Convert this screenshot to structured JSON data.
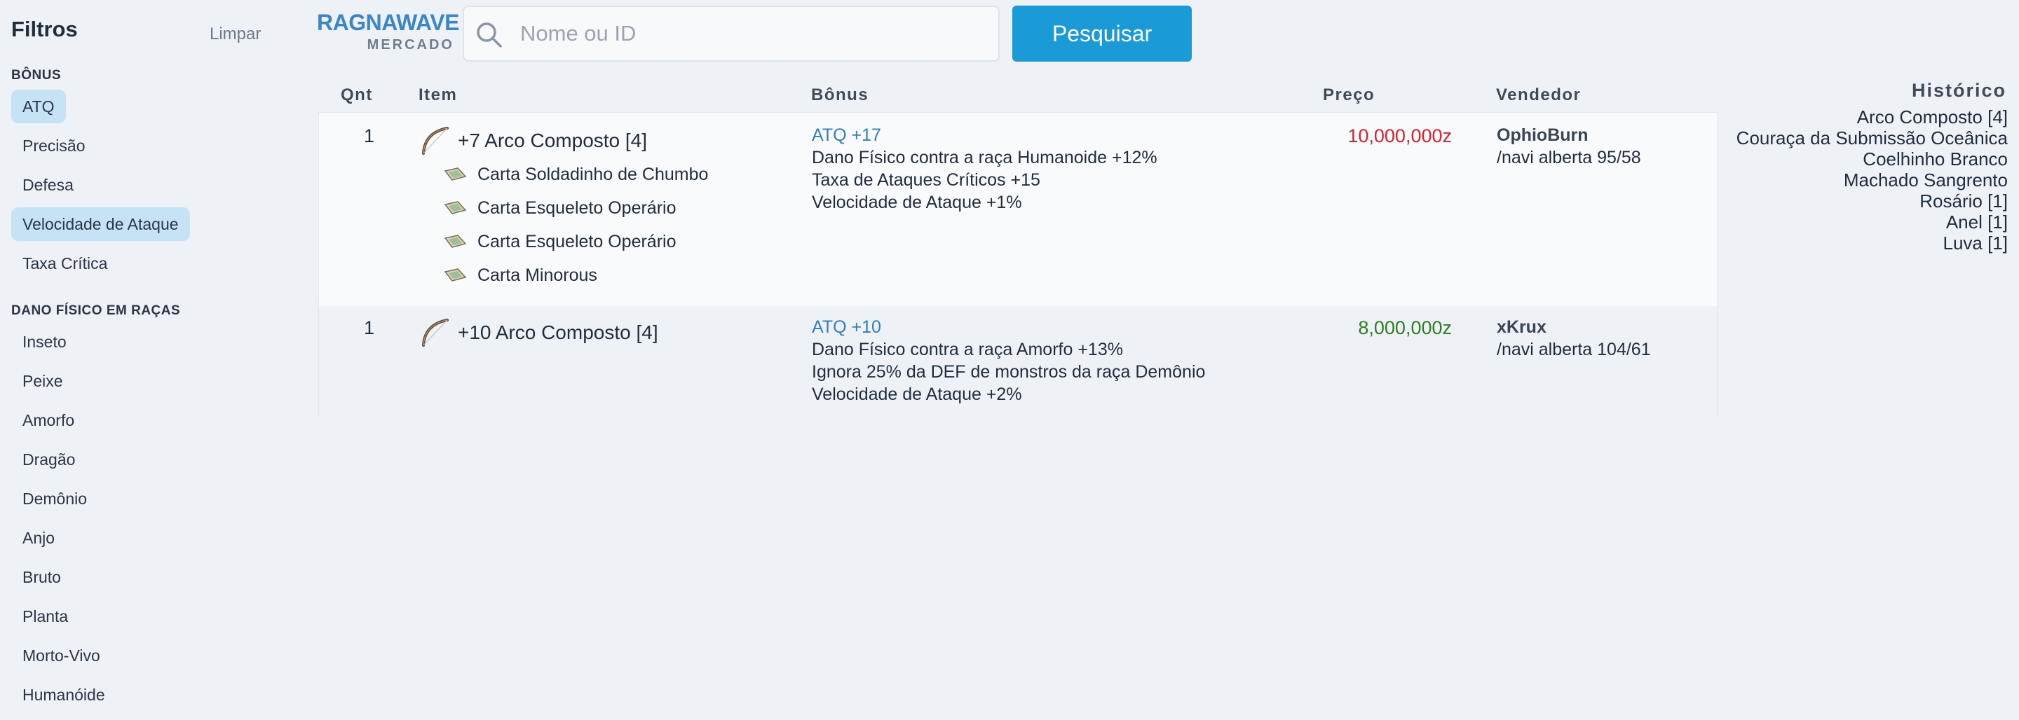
{
  "sidebar": {
    "title": "Filtros",
    "clear_label": "Limpar",
    "sections": [
      {
        "title": "BÔNUS",
        "items": [
          {
            "label": "ATQ",
            "active": true
          },
          {
            "label": "Precisão",
            "active": false
          },
          {
            "label": "Defesa",
            "active": false
          },
          {
            "label": "Velocidade de Ataque",
            "active": true
          },
          {
            "label": "Taxa Crítica",
            "active": false
          }
        ]
      },
      {
        "title": "DANO FÍSICO EM RAÇAS",
        "items": [
          {
            "label": "Inseto"
          },
          {
            "label": "Peixe"
          },
          {
            "label": "Amorfo"
          },
          {
            "label": "Dragão"
          },
          {
            "label": "Demônio"
          },
          {
            "label": "Anjo"
          },
          {
            "label": "Bruto"
          },
          {
            "label": "Planta"
          },
          {
            "label": "Morto-Vivo"
          },
          {
            "label": "Humanóide"
          }
        ]
      }
    ]
  },
  "header": {
    "logo_main": "RAGNAWAVE",
    "logo_sub": "MERCADO",
    "search_placeholder": "Nome ou ID",
    "search_value": "",
    "search_button": "Pesquisar"
  },
  "table": {
    "columns": [
      "Qnt",
      "Item",
      "Bônus",
      "Preço",
      "Vendedor"
    ],
    "rows": [
      {
        "qty": "1",
        "item": "+7 Arco Composto [4]",
        "icon": "bow-icon",
        "cards": [
          "Carta Soldadinho de Chumbo",
          "Carta Esqueleto Operário",
          "Carta Esqueleto Operário",
          "Carta Minorous"
        ],
        "bonuses": [
          "ATQ +17",
          "Dano Físico contra a raça Humanoide +12%",
          "Taxa de Ataques Críticos +15",
          "Velocidade de Ataque +1%"
        ],
        "price": "10,000,000z",
        "price_color": "#e0202e",
        "seller": "OphioBurn",
        "location": "/navi alberta 95/58"
      },
      {
        "qty": "1",
        "item": "+10 Arco Composto [4]",
        "icon": "bow-icon",
        "cards": [],
        "bonuses": [
          "ATQ +10",
          "Dano Físico contra a raça Amorfo +13%",
          "Ignora 25% da DEF de monstros da raça Demônio",
          "Velocidade de Ataque +2%"
        ],
        "price": "8,000,000z",
        "price_color": "#2e7d22",
        "seller": "xKrux",
        "location": "/navi alberta 104/61"
      }
    ]
  },
  "history": {
    "title": "Histórico",
    "items": [
      "Arco Composto [4]",
      "Couraça da Submissão Oceânica",
      "Coelhinho Branco",
      "Machado Sangrento",
      "Rosário [1]",
      "Anel [1]",
      "Luva [1]"
    ]
  },
  "colors": {
    "accent": "#1a9bd7",
    "logo": "#3a86c8",
    "active_filter": "#c6e2f5",
    "bonus_highlight": "#2f7fc1"
  }
}
